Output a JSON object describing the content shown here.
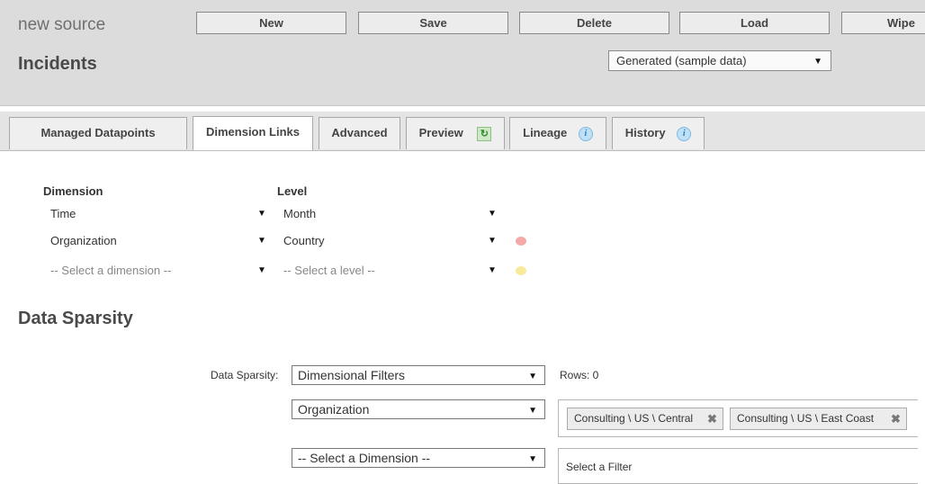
{
  "header": {
    "source_name": "new source",
    "title": "Incidents",
    "buttons": {
      "new": "New",
      "save": "Save",
      "delete": "Delete",
      "load": "Load",
      "wipe": "Wipe"
    },
    "data_source_select": "Generated (sample data)"
  },
  "tabs": [
    {
      "label": "Managed Datapoints",
      "active": false
    },
    {
      "label": "Dimension Links",
      "active": true
    },
    {
      "label": "Advanced",
      "active": false
    },
    {
      "label": "Preview",
      "active": false,
      "icon": "refresh-icon"
    },
    {
      "label": "Lineage",
      "active": false,
      "icon": "info-icon"
    },
    {
      "label": "History",
      "active": false,
      "icon": "info-icon"
    }
  ],
  "dimension_links": {
    "dimension_header": "Dimension",
    "level_header": "Level",
    "rows": [
      {
        "dimension": "Time",
        "level": "Month",
        "icon": "none"
      },
      {
        "dimension": "Organization",
        "level": "Country",
        "icon": "database-icon-red"
      },
      {
        "dimension": "-- Select a dimension --",
        "level": "-- Select a level --",
        "icon": "database-icon-yellow",
        "placeholder": true
      }
    ],
    "icon_colors": {
      "red": "#f4a8a8",
      "yellow": "#f7ea9a"
    }
  },
  "sparsity": {
    "title": "Data Sparsity",
    "label": "Data Sparsity:",
    "mode_select": "Dimensional Filters",
    "rows_text": "Rows: 0",
    "filters": [
      {
        "dimension": "Organization",
        "chips": [
          "Consulting \\ US \\ Central",
          "Consulting \\ US \\ East Coast"
        ]
      },
      {
        "dimension": "-- Select a Dimension --",
        "placeholder": "Select a Filter"
      }
    ]
  },
  "glyphs": {
    "dropdown_arrow": "▼",
    "chip_remove": "✖",
    "info": "i",
    "refresh": "↻"
  }
}
